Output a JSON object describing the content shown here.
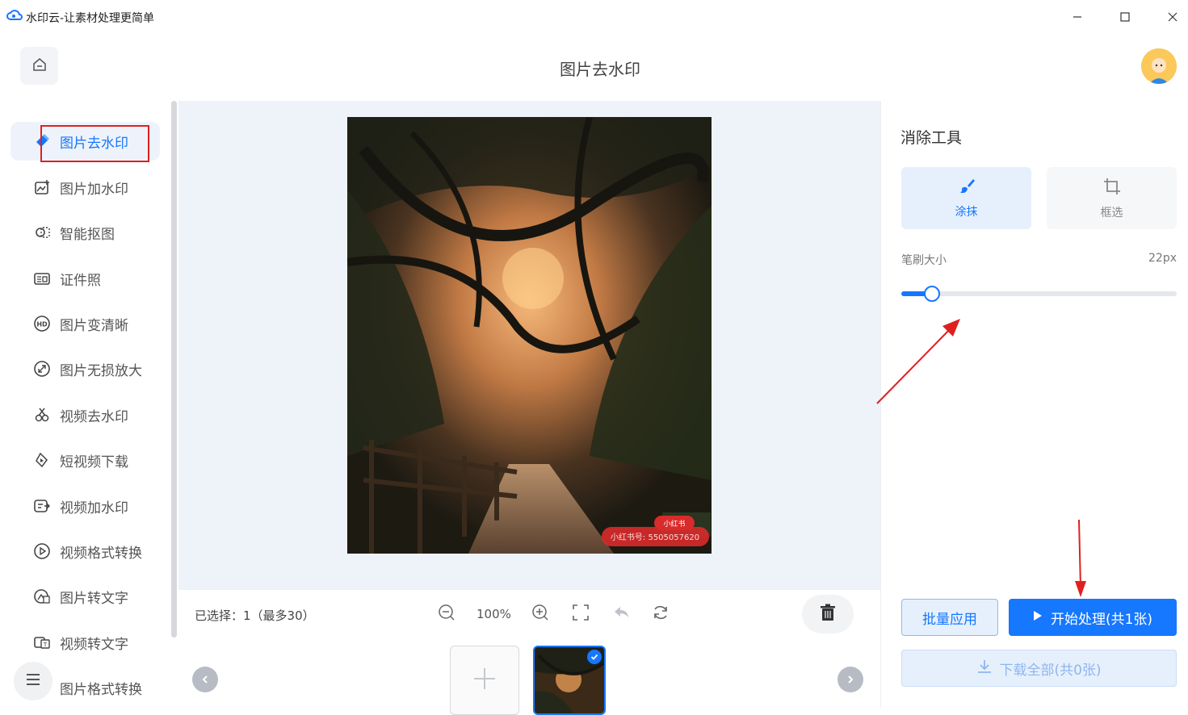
{
  "window": {
    "title": "水印云-让素材处理更简单"
  },
  "header": {
    "title": "图片去水印"
  },
  "sidebar": {
    "items": [
      {
        "label": "图片去水印",
        "icon": "eraser-pen-icon",
        "active": true
      },
      {
        "label": "图片加水印",
        "icon": "image-add-icon"
      },
      {
        "label": "智能抠图",
        "icon": "cutout-icon"
      },
      {
        "label": "证件照",
        "icon": "id-card-icon"
      },
      {
        "label": "图片变清晰",
        "icon": "hd-icon"
      },
      {
        "label": "图片无损放大",
        "icon": "enlarge-icon"
      },
      {
        "label": "视频去水印",
        "icon": "video-erase-icon"
      },
      {
        "label": "短视频下载",
        "icon": "video-download-icon"
      },
      {
        "label": "视频加水印",
        "icon": "video-add-icon"
      },
      {
        "label": "视频格式转换",
        "icon": "video-convert-icon"
      },
      {
        "label": "图片转文字",
        "icon": "image-to-text-icon"
      },
      {
        "label": "视频转文字",
        "icon": "video-to-text-icon"
      },
      {
        "label": "图片格式转换",
        "icon": "image-convert-icon"
      }
    ]
  },
  "canvas": {
    "watermark_badge": "小红书",
    "watermark_text": "小红书号: 5505057620"
  },
  "toolbar": {
    "selection": "已选择：1（最多30）",
    "zoom": "100%"
  },
  "panel": {
    "title": "消除工具",
    "tools": [
      {
        "label": "涂抹",
        "active": true
      },
      {
        "label": "框选",
        "active": false
      }
    ],
    "brush_label": "笔刷大小",
    "brush_value": "22px",
    "brush_level": 0.11,
    "batch_button": "批量应用",
    "start_button": "开始处理(共1张)",
    "download_button": "下载全部(共0张)"
  },
  "colors": {
    "accent": "#1677ff",
    "annotation": "#e02020"
  }
}
